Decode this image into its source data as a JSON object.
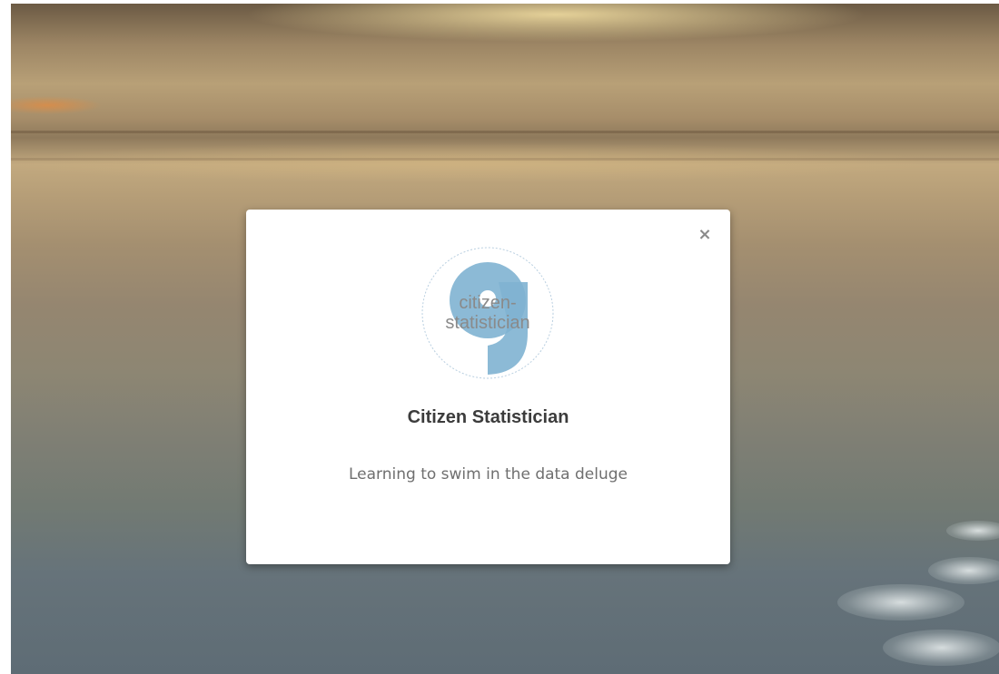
{
  "modal": {
    "close_label": "×",
    "logo": {
      "line1": "citizen-",
      "line2": "statistician",
      "accent_color": "#7fb3d1"
    },
    "title": "Citizen Statistician",
    "tagline": "Learning to swim in the data deluge"
  }
}
